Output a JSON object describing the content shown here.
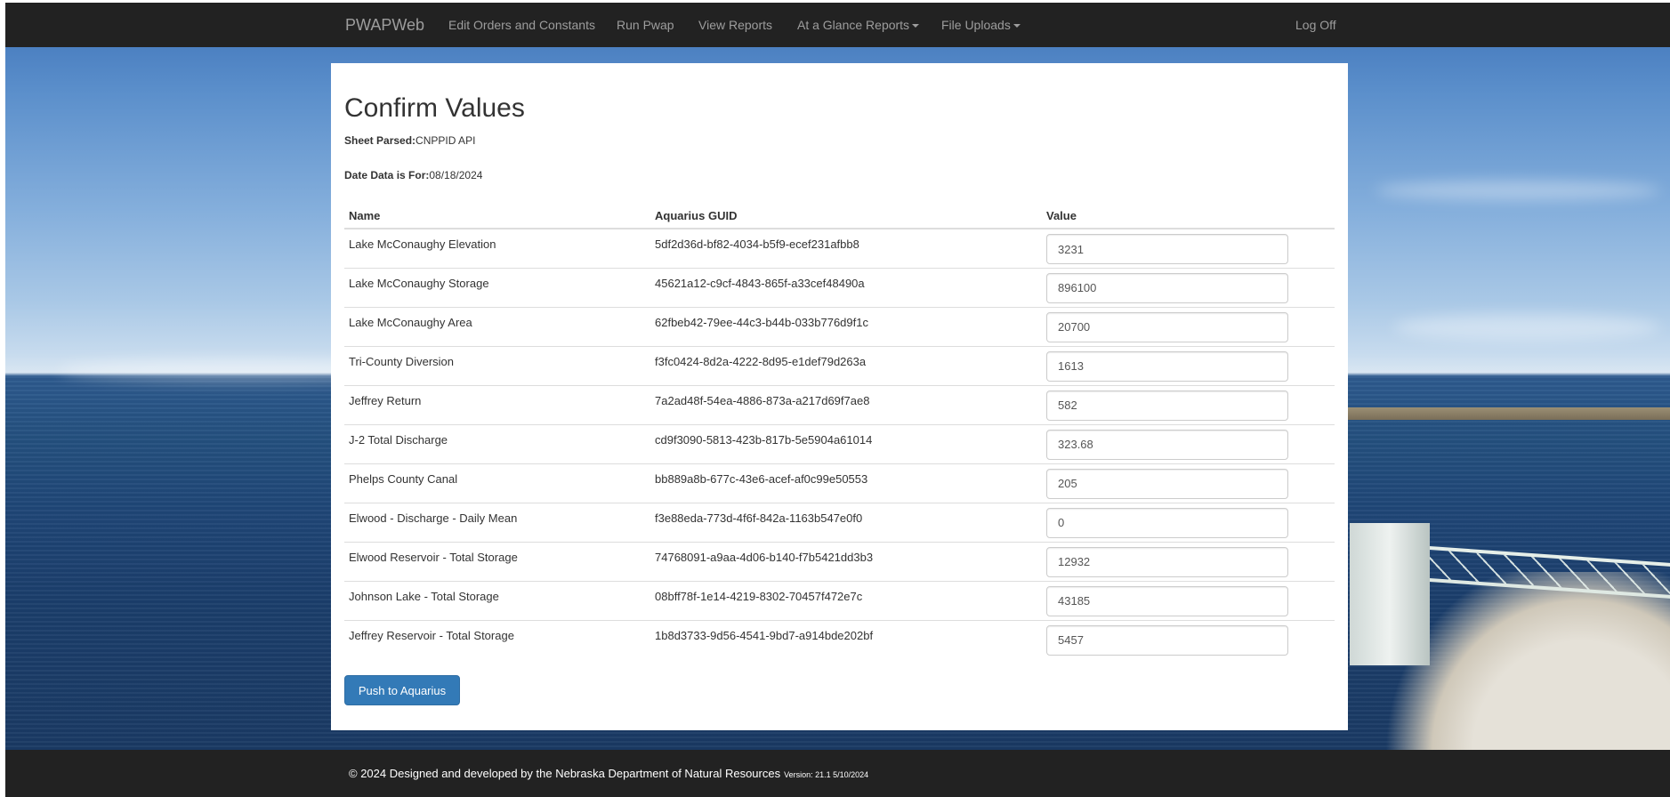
{
  "navbar": {
    "brand": "PWAPWeb",
    "items": [
      {
        "label": "Edit Orders and Constants",
        "dropdown": false
      },
      {
        "label": "Run Pwap",
        "dropdown": false
      },
      {
        "label": "View Reports",
        "dropdown": false
      },
      {
        "label": "At a Glance Reports",
        "dropdown": true
      },
      {
        "label": "File Uploads",
        "dropdown": true
      }
    ],
    "logoff": "Log Off"
  },
  "page": {
    "title": "Confirm Values",
    "sheet_parsed_label": "Sheet Parsed:",
    "sheet_parsed_value": "CNPPID API",
    "date_label": "Date Data is For:",
    "date_value": "08/18/2024"
  },
  "table": {
    "headers": [
      "Name",
      "Aquarius GUID",
      "Value"
    ],
    "rows": [
      {
        "name": "Lake McConaughy Elevation",
        "guid": "5df2d36d-bf82-4034-b5f9-ecef231afbb8",
        "value": "3231"
      },
      {
        "name": "Lake McConaughy Storage",
        "guid": "45621a12-c9cf-4843-865f-a33cef48490a",
        "value": "896100"
      },
      {
        "name": "Lake McConaughy Area",
        "guid": "62fbeb42-79ee-44c3-b44b-033b776d9f1c",
        "value": "20700"
      },
      {
        "name": "Tri-County Diversion",
        "guid": "f3fc0424-8d2a-4222-8d95-e1def79d263a",
        "value": "1613"
      },
      {
        "name": "Jeffrey Return",
        "guid": "7a2ad48f-54ea-4886-873a-a217d69f7ae8",
        "value": "582"
      },
      {
        "name": "J-2 Total Discharge",
        "guid": "cd9f3090-5813-423b-817b-5e5904a61014",
        "value": "323.68"
      },
      {
        "name": "Phelps County Canal",
        "guid": "bb889a8b-677c-43e6-acef-af0c99e50553",
        "value": "205"
      },
      {
        "name": "Elwood - Discharge - Daily Mean",
        "guid": "f3e88eda-773d-4f6f-842a-1163b547e0f0",
        "value": "0"
      },
      {
        "name": "Elwood Reservoir - Total Storage",
        "guid": "74768091-a9aa-4d06-b140-f7b5421dd3b3",
        "value": "12932"
      },
      {
        "name": "Johnson Lake - Total Storage",
        "guid": "08bff78f-1e14-4219-8302-70457f472e7c",
        "value": "43185"
      },
      {
        "name": "Jeffrey Reservoir - Total Storage",
        "guid": "1b8d3733-9d56-4541-9bd7-a914bde202bf",
        "value": "5457"
      }
    ]
  },
  "actions": {
    "push_label": "Push to Aquarius"
  },
  "footer": {
    "copyright": "© 2024 Designed and developed by the Nebraska Department of Natural Resources",
    "version": "Version: 21.1 5/10/2024"
  },
  "colors": {
    "navbar": "#222222",
    "primary_button": "#337ab7",
    "panel": "#ffffff"
  }
}
